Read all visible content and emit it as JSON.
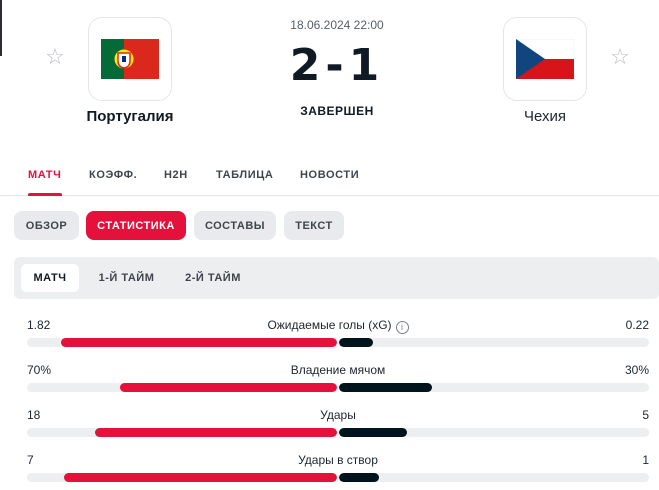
{
  "match": {
    "datetime": "18.06.2024 22:00",
    "score": "2-1",
    "status": "ЗАВЕРШЕН",
    "home_team": "Португалия",
    "away_team": "Чехия"
  },
  "colors": {
    "accent": "#e5103c",
    "away_bar": "#00141e",
    "track": "#eceef0"
  },
  "icons": {
    "favorite": "star-outline-icon",
    "info": "info-circle-icon"
  },
  "tabs": [
    {
      "label": "МАТЧ",
      "active": true
    },
    {
      "label": "КОЭФФ.",
      "active": false
    },
    {
      "label": "H2H",
      "active": false
    },
    {
      "label": "ТАБЛИЦА",
      "active": false
    },
    {
      "label": "НОВОСТИ",
      "active": false
    }
  ],
  "subtabs": [
    {
      "label": "ОБЗОР",
      "active": false
    },
    {
      "label": "СТАТИСТИКА",
      "active": true
    },
    {
      "label": "СОСТАВЫ",
      "active": false
    },
    {
      "label": "ТЕКСТ",
      "active": false
    }
  ],
  "periods": [
    {
      "label": "МАТЧ",
      "active": true
    },
    {
      "label": "1-Й ТАЙМ",
      "active": false
    },
    {
      "label": "2-Й ТАЙМ",
      "active": false
    }
  ],
  "stats": [
    {
      "name": "Ожидаемые голы (xG)",
      "home": "1.82",
      "away": "0.22",
      "home_share": 0.89,
      "away_share": 0.11,
      "info": true
    },
    {
      "name": "Владение мячом",
      "home": "70%",
      "away": "30%",
      "home_share": 0.7,
      "away_share": 0.3,
      "info": false
    },
    {
      "name": "Удары",
      "home": "18",
      "away": "5",
      "home_share": 0.78,
      "away_share": 0.22,
      "info": false
    },
    {
      "name": "Удары в створ",
      "home": "7",
      "away": "1",
      "home_share": 0.875,
      "away_share": 0.13,
      "info": false
    }
  ]
}
